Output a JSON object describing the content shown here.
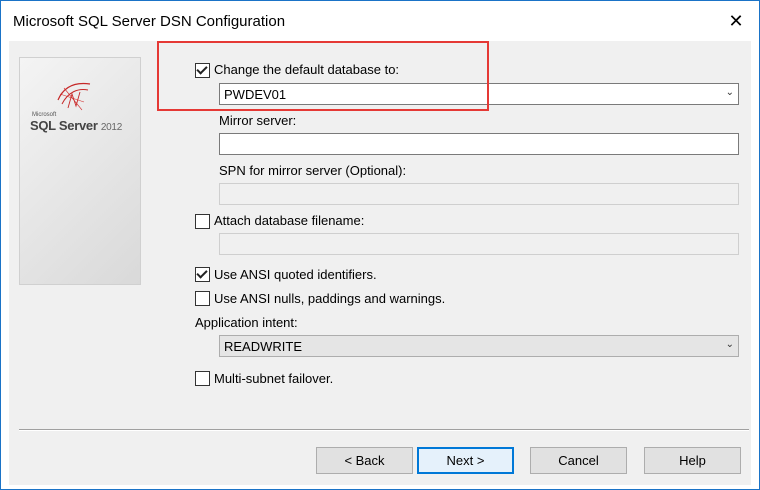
{
  "window": {
    "title": "Microsoft SQL Server DSN Configuration",
    "close_icon": "close-icon"
  },
  "side_panel": {
    "logo_small": "Microsoft",
    "logo_name": "SQL Server",
    "logo_version": "2012"
  },
  "options": {
    "change_db": {
      "label": "Change the default database to:",
      "checked": true,
      "value": "PWDEV01"
    },
    "mirror_server": {
      "label": "Mirror server:",
      "value": ""
    },
    "spn": {
      "label": "SPN for mirror server (Optional):",
      "value": ""
    },
    "attach_db": {
      "label": "Attach database filename:",
      "checked": false,
      "value": ""
    },
    "ansi_quoted": {
      "label": "Use ANSI quoted identifiers.",
      "checked": true
    },
    "ansi_nulls": {
      "label": "Use ANSI nulls, paddings and warnings.",
      "checked": false
    },
    "app_intent": {
      "label": "Application intent:",
      "value": "READWRITE"
    },
    "multi_subnet": {
      "label": "Multi-subnet failover.",
      "checked": false
    }
  },
  "buttons": {
    "back": "< Back",
    "next": "Next >",
    "cancel": "Cancel",
    "help": "Help"
  },
  "colors": {
    "highlight": "#e53935",
    "accent": "#0078d7"
  }
}
